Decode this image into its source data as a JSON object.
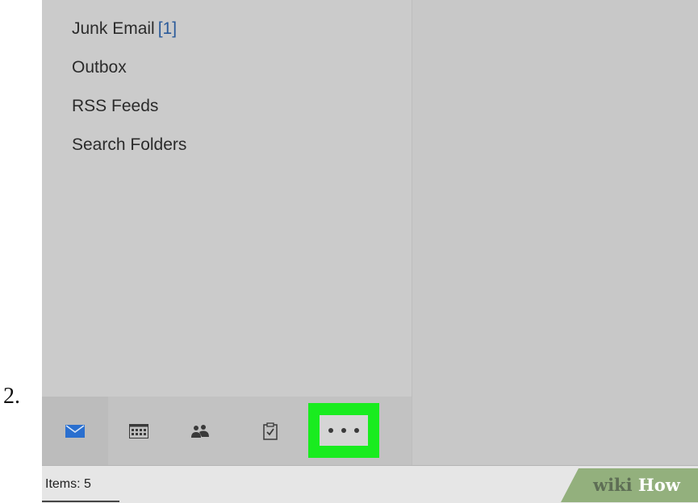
{
  "step_number": "2.",
  "folders": [
    {
      "label": "Junk Email",
      "count": "[1]"
    },
    {
      "label": "Outbox",
      "count": ""
    },
    {
      "label": "RSS Feeds",
      "count": ""
    },
    {
      "label": "Search Folders",
      "count": ""
    }
  ],
  "nav": {
    "items": [
      "mail-icon",
      "calendar-icon",
      "people-icon",
      "tasks-icon",
      "more-options-icon"
    ],
    "more_label": "•••"
  },
  "status_bar": {
    "text": "Items: 5"
  },
  "watermark": {
    "wiki": "wiki",
    "how": "How"
  },
  "colors": {
    "highlight": "#19ec1f",
    "mail_icon": "#2a6fcf",
    "folder_count": "#2a5a9a"
  }
}
